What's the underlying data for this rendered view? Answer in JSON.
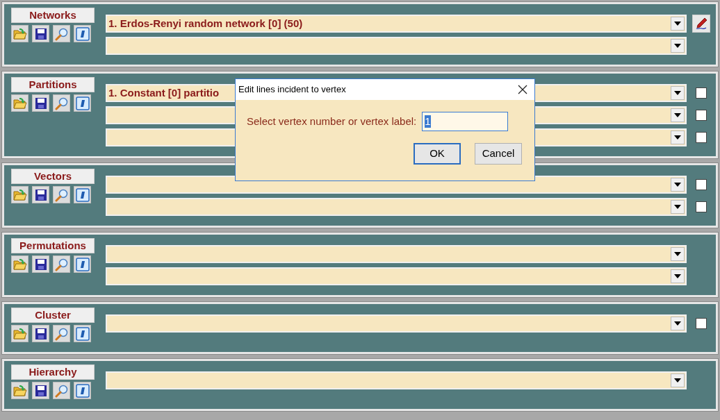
{
  "panels": [
    {
      "title": "Networks",
      "rows": [
        {
          "kind": "edit",
          "value": "1. Erdos-Renyi random network [0] (50)"
        },
        {
          "kind": "plain"
        }
      ]
    },
    {
      "title": "Partitions",
      "rows": [
        {
          "kind": "checkbox",
          "checked": false,
          "value": "1. Constant [0] partitio"
        },
        {
          "kind": "checkbox",
          "checked": false
        },
        {
          "kind": "checkbox",
          "checked": false
        }
      ]
    },
    {
      "title": "Vectors",
      "rows": [
        {
          "kind": "checkbox",
          "checked": false
        },
        {
          "kind": "checkbox",
          "checked": false
        }
      ]
    },
    {
      "title": "Permutations",
      "rows": [
        {
          "kind": "plain"
        },
        {
          "kind": "plain"
        }
      ]
    },
    {
      "title": "Cluster",
      "rows": [
        {
          "kind": "checkbox",
          "checked": false
        }
      ]
    },
    {
      "title": "Hierarchy",
      "rows": [
        {
          "kind": "plain"
        }
      ]
    }
  ],
  "dialog": {
    "title": "Edit lines incident to vertex",
    "label": "Select vertex number or vertex label:",
    "value": "1",
    "buttons": [
      {
        "label": "OK",
        "default": true
      },
      {
        "label": "Cancel",
        "default": false
      }
    ]
  }
}
